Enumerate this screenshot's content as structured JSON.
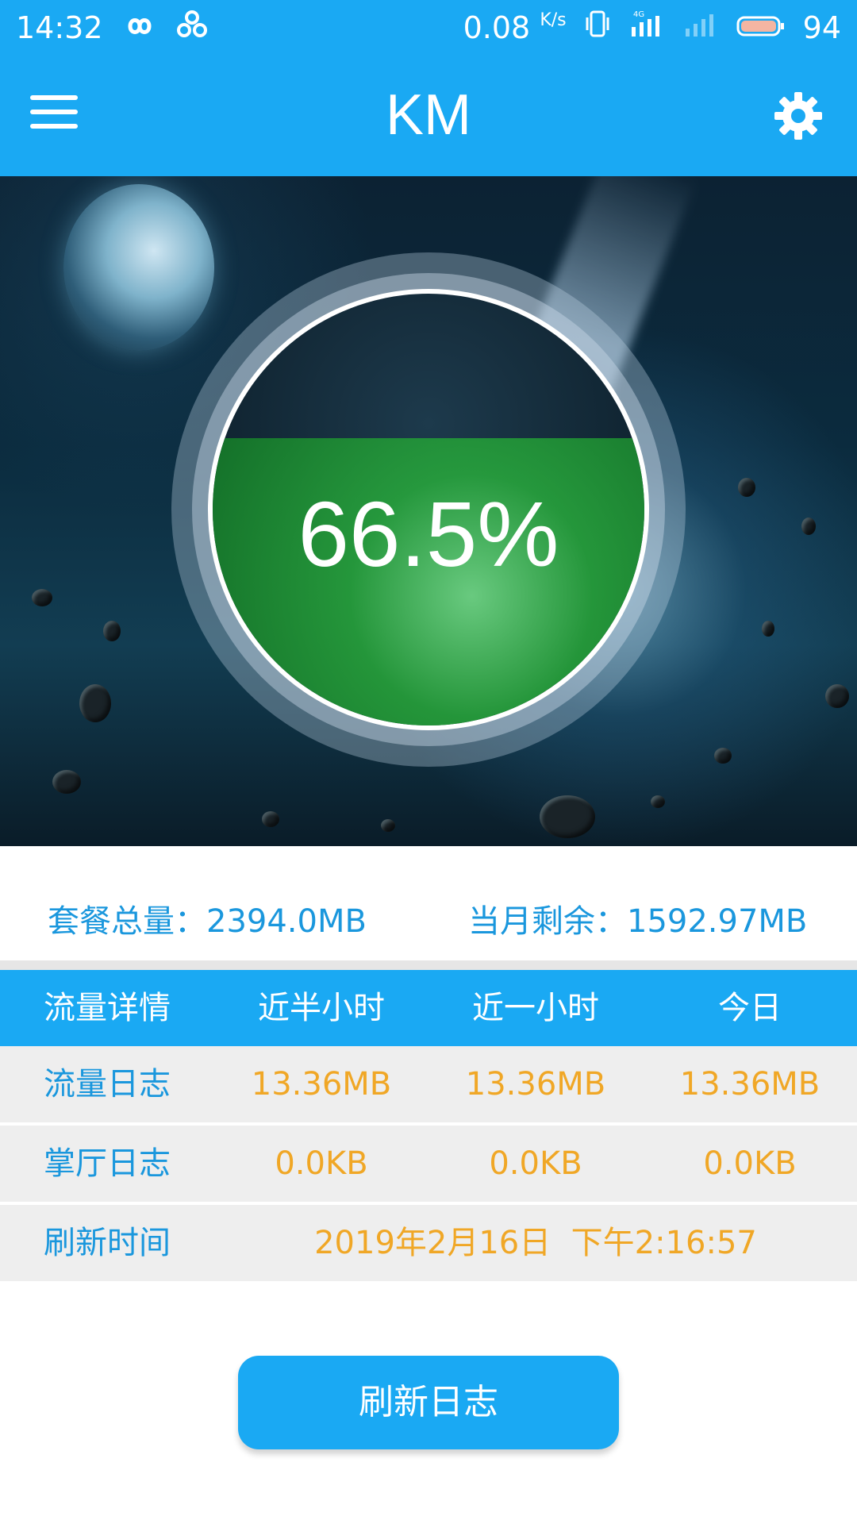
{
  "status_bar": {
    "time": "14:32",
    "speed": "0.08",
    "speed_unit": "K/s",
    "network": "4G",
    "battery": "94",
    "icons": [
      "infinity-icon",
      "link-icon",
      "vibrate-icon",
      "signal-4g-icon",
      "signal-icon",
      "battery-icon"
    ]
  },
  "app_bar": {
    "title": "KM",
    "menu_icon": "hamburger-menu-icon",
    "settings_icon": "gear-icon"
  },
  "gauge": {
    "percent_text": "66.5%",
    "fill_fraction": 0.665,
    "fill_color": "#2fb94a"
  },
  "summary": {
    "total_label": "套餐总量：",
    "total_value": "2394.0MB",
    "remaining_label": "当月剩余：",
    "remaining_value": "1592.97MB"
  },
  "table": {
    "headers": [
      "流量详情",
      "近半小时",
      "近一小时",
      "今日"
    ],
    "rows": [
      {
        "label": "流量日志",
        "values": [
          "13.36MB",
          "13.36MB",
          "13.36MB"
        ]
      },
      {
        "label": "掌厅日志",
        "values": [
          "0.0KB",
          "0.0KB",
          "0.0KB"
        ]
      }
    ],
    "refresh_row": {
      "label": "刷新时间",
      "value": "2019年2月16日  下午2:16:57"
    }
  },
  "button": {
    "label": "刷新日志"
  },
  "colors": {
    "primary": "#1aa9f3",
    "label_blue": "#1a97dd",
    "value_orange": "#f0a726",
    "row_bg": "#eeeeee"
  }
}
